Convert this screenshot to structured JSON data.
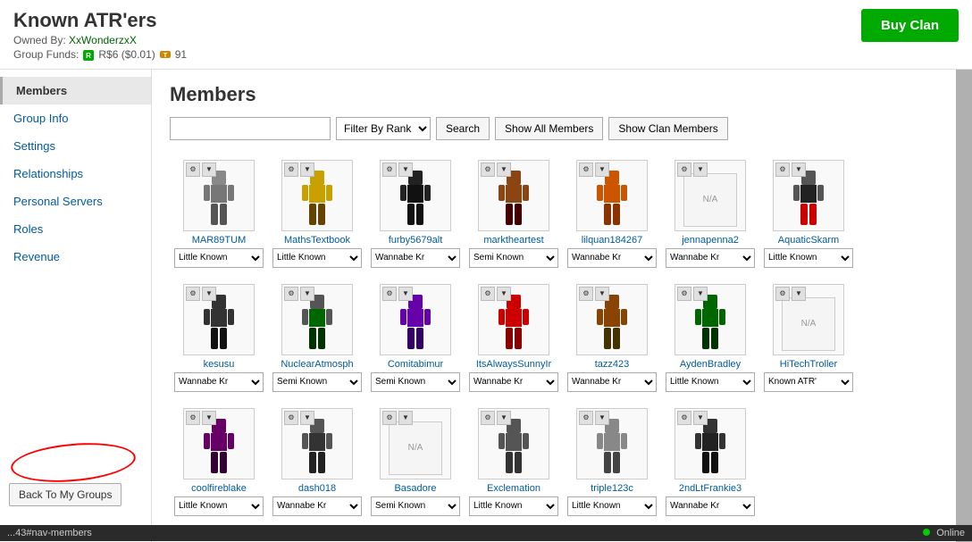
{
  "header": {
    "title": "Known ATR'ers",
    "owned_by_label": "Owned By:",
    "owner_name": "XxWonderzxX",
    "funds_label": "Group Funds:",
    "funds_robux": "R$6 ($0.01)",
    "funds_tickets": "91",
    "buy_btn": "Buy Clan"
  },
  "sidebar": {
    "items": [
      {
        "label": "Members",
        "active": true
      },
      {
        "label": "Group Info",
        "active": false
      },
      {
        "label": "Settings",
        "active": false
      },
      {
        "label": "Relationships",
        "active": false
      },
      {
        "label": "Personal Servers",
        "active": false
      },
      {
        "label": "Roles",
        "active": false
      },
      {
        "label": "Revenue",
        "active": false
      }
    ],
    "back_btn": "Back To My Groups"
  },
  "main": {
    "title": "Members",
    "search_placeholder": "",
    "filter_label": "Filter By Rank",
    "search_btn": "Search",
    "show_all_btn": "Show All Members",
    "show_clan_btn": "Show Clan Members",
    "ranks": [
      "Little Known",
      "Wannabe Kr",
      "Semi Known",
      "Known ATR'",
      "Little Known"
    ],
    "members": [
      {
        "name": "MAR89TUM",
        "rank": "Little Known",
        "color": "#666"
      },
      {
        "name": "MathsTextbook",
        "rank": "Little Known",
        "color": "#c8a000"
      },
      {
        "name": "furby5679alt",
        "rank": "Wannabe Kr",
        "color": "#222"
      },
      {
        "name": "marktheartest",
        "rank": "Semi Known",
        "color": "#8B4513"
      },
      {
        "name": "lilquan184267",
        "rank": "Wannabe Kr",
        "color": "#cc5500"
      },
      {
        "name": "jennapenna2",
        "rank": "Wannabe Kr",
        "color": "#888",
        "na": true
      },
      {
        "name": "AquaticSkarm",
        "rank": "Little Known",
        "color": "#222"
      },
      {
        "name": "kesusu",
        "rank": "Wannabe Kr",
        "color": "#333"
      },
      {
        "name": "NuclearAtmosph",
        "rank": "Semi Known",
        "color": "#006600"
      },
      {
        "name": "Comitabimur",
        "rank": "Semi Known",
        "color": "#6600aa"
      },
      {
        "name": "ItsAlwaysSunnyIr",
        "rank": "Wannabe Kr",
        "color": "#cc0000"
      },
      {
        "name": "tazz423",
        "rank": "Wannabe Kr",
        "color": "#884400"
      },
      {
        "name": "AydenBradley",
        "rank": "Little Known",
        "color": "#008800"
      },
      {
        "name": "HiTechTroller",
        "rank": "Known ATR'",
        "color": "#888",
        "na": true
      },
      {
        "name": "coolfireblake",
        "rank": "Little Known",
        "color": "#660066"
      },
      {
        "name": "dash018",
        "rank": "Wannabe Kr",
        "color": "#555"
      },
      {
        "name": "Basadore",
        "rank": "Semi Known",
        "color": "#888",
        "na": true
      },
      {
        "name": "Exclemation",
        "rank": "Little Known",
        "color": "#555"
      },
      {
        "name": "triple123c",
        "rank": "Little Known",
        "color": "#888"
      },
      {
        "name": "2ndLtFrankie3",
        "rank": "Wannabe Kr",
        "color": "#333"
      }
    ]
  },
  "status_bar": {
    "url": "...43#nav-members",
    "online_label": "Online"
  }
}
